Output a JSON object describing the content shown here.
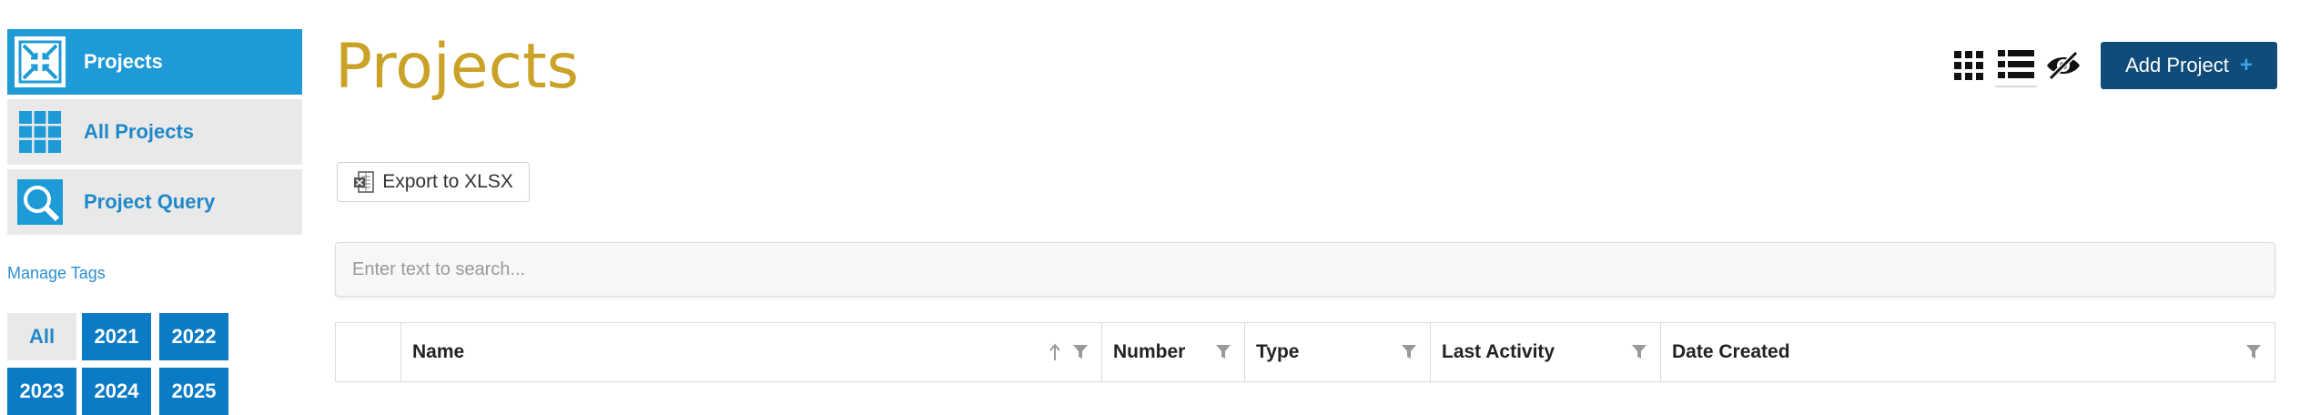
{
  "sidebar": {
    "items": [
      {
        "label": "Projects",
        "icon": "projects-icon",
        "active": true
      },
      {
        "label": "All Projects",
        "icon": "grid-icon",
        "active": false
      },
      {
        "label": "Project Query",
        "icon": "search-icon",
        "active": false
      }
    ],
    "manage_tags": "Manage Tags",
    "tags": [
      "All",
      "2021",
      "2022",
      "2023",
      "2024",
      "2025"
    ]
  },
  "header": {
    "title": "Projects",
    "add_button": "Add Project",
    "add_icon": "+"
  },
  "toolbar": {
    "export_label": "Export to XLSX"
  },
  "search": {
    "placeholder": "Enter text to search..."
  },
  "table": {
    "columns": [
      "",
      "Name",
      "Number",
      "Type",
      "Last Activity",
      "Date Created"
    ]
  },
  "colors": {
    "accent": "#1e9bd7",
    "title": "#c9a227",
    "primary_button": "#0f4c7a",
    "tag": "#0a7bc4"
  }
}
